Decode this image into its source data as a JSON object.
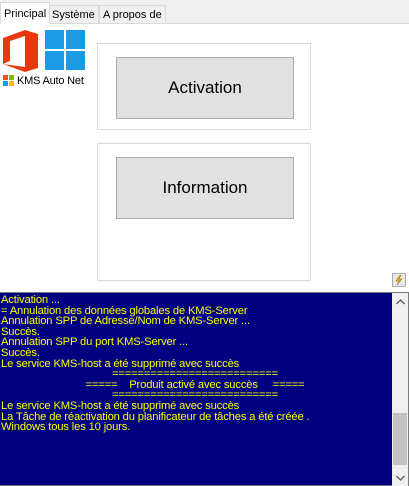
{
  "tabs": [
    {
      "label": "Principal",
      "active": true
    },
    {
      "label": "Système",
      "active": false
    },
    {
      "label": "A propos de",
      "active": false
    }
  ],
  "brand": {
    "label": "KMS Auto Net",
    "office_color": "#e8390e",
    "windows_color": "#1c9ae6",
    "ms_colors": [
      "#f25022",
      "#7fba00",
      "#00a4ef",
      "#ffb900"
    ]
  },
  "buttons": {
    "activation": "Activation",
    "information": "Information"
  },
  "console": {
    "background": "#000080",
    "text_color": "#ffff00",
    "lines": [
      "Activation ...",
      "= Annulation des données globales de KMS-Server",
      "Annulation SPP de Adresse/Nom de KMS-Server ...",
      "Succès.",
      "Annulation SPP du port KMS-Server ...",
      "Succès.",
      "Le service KMS-host a été supprimé avec succès",
      "==========================",
      "=====    Produit activé avec succès     =====",
      "==========================",
      "Le service KMS-host a été supprimé avec succès",
      "La Tâche de réactivation du planificateur de tâches a été créée .",
      "Windows tous les 10 jours."
    ],
    "centered_lines": [
      7,
      8,
      9
    ]
  }
}
